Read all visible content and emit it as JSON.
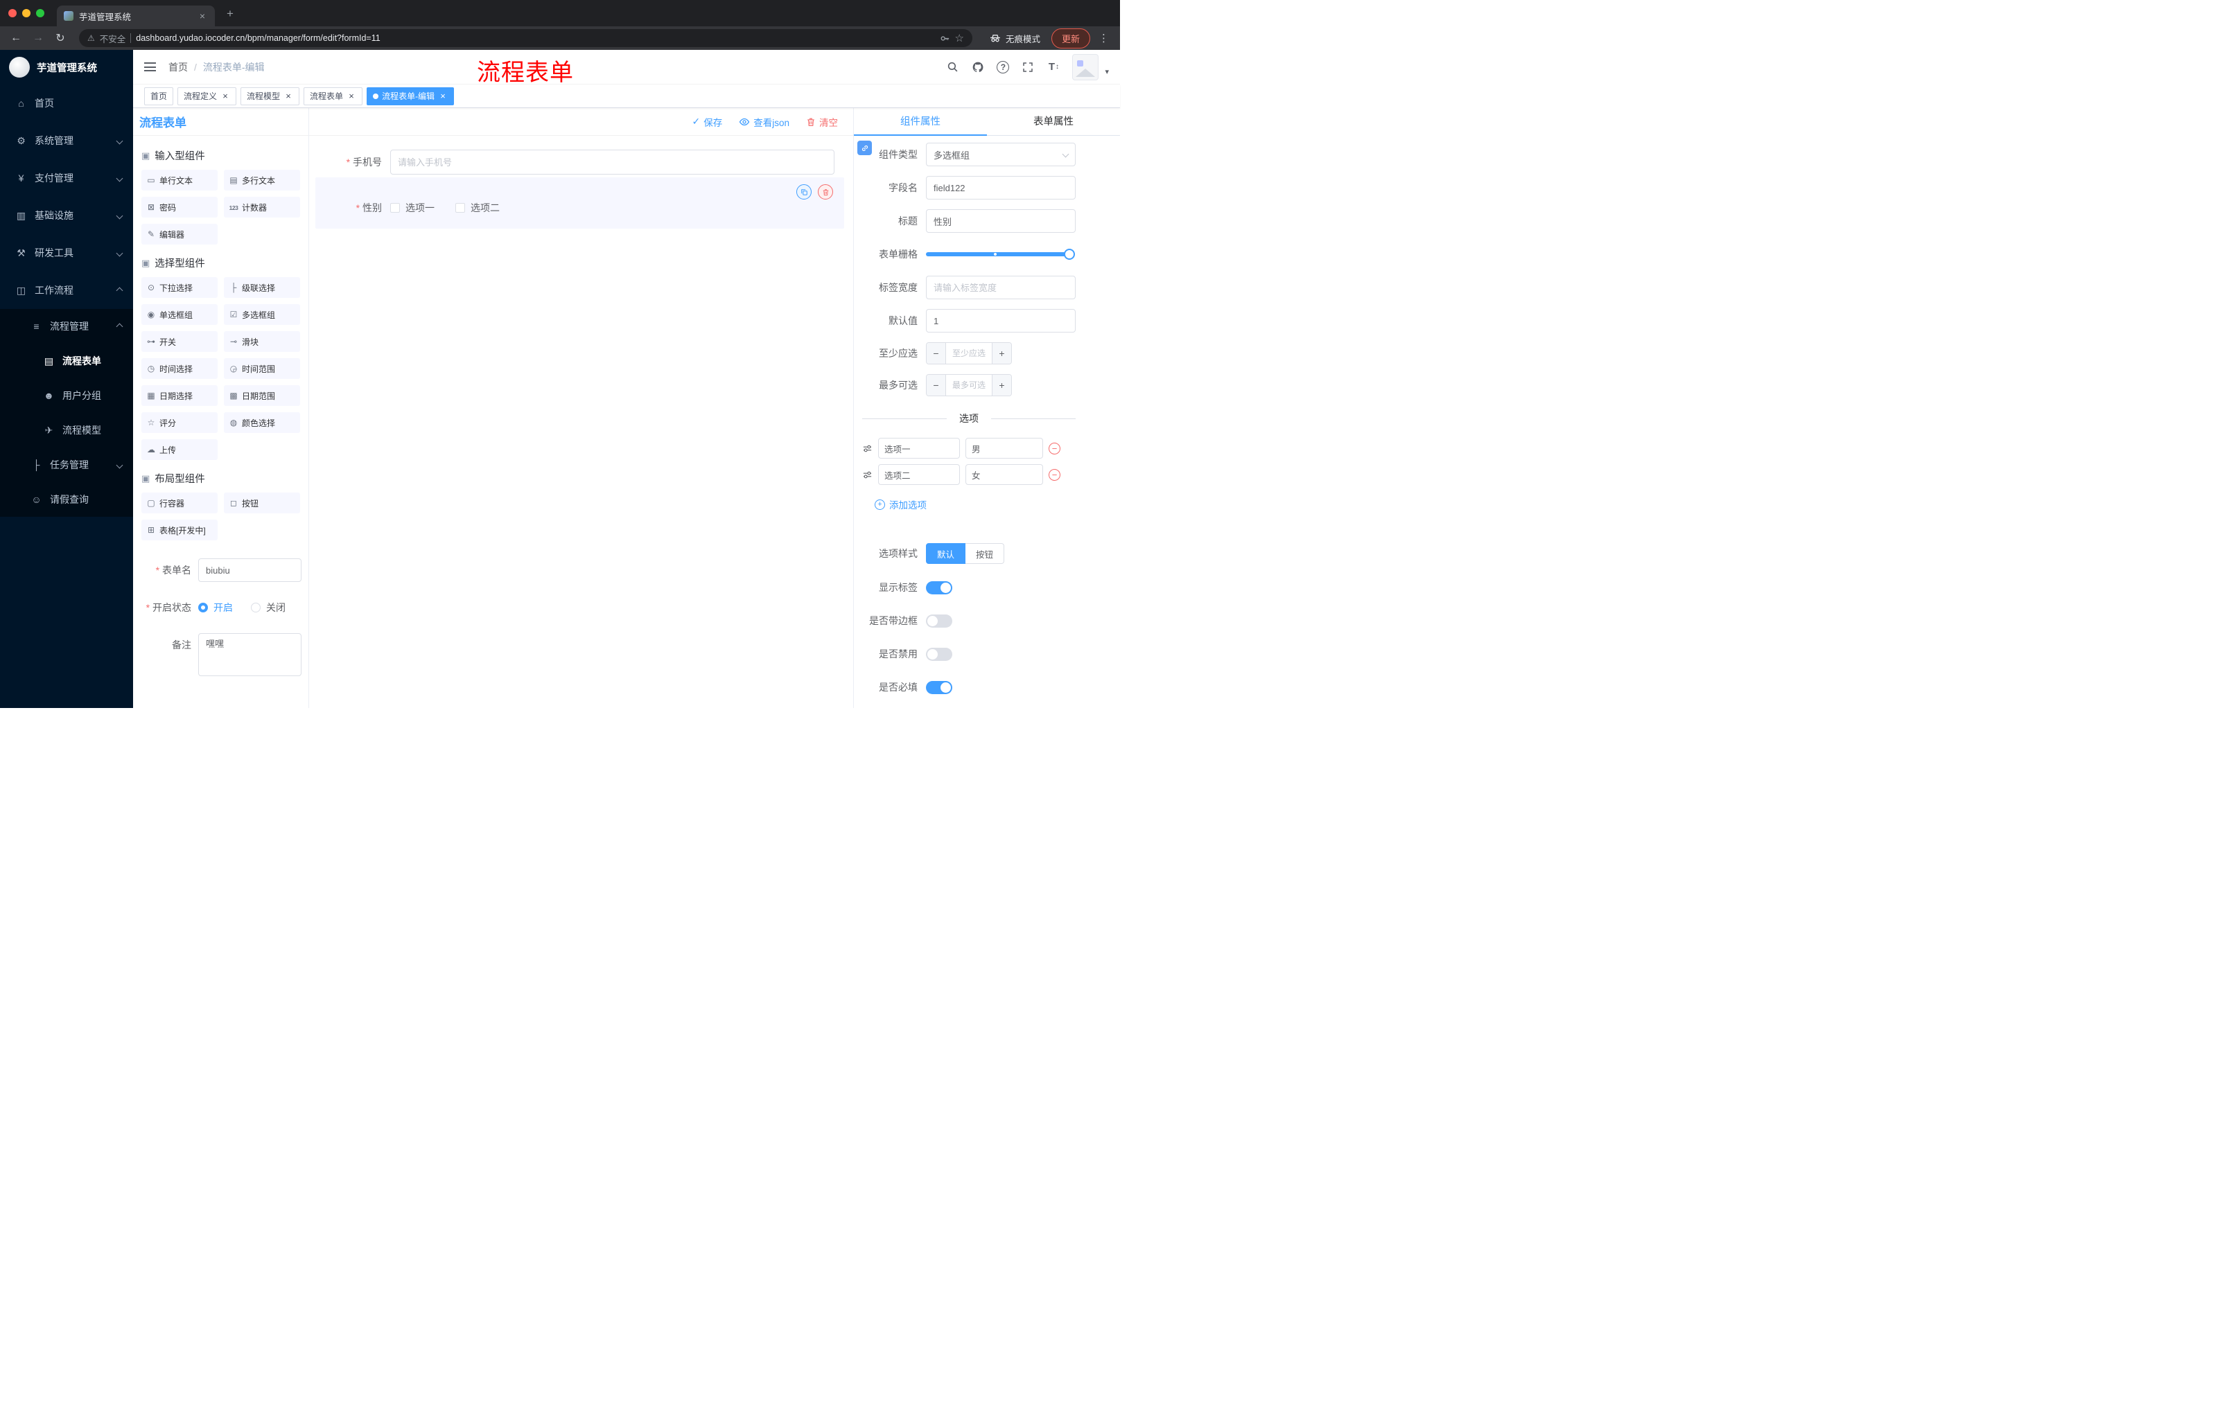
{
  "browser": {
    "tab_title": "芋道管理系统",
    "security_label": "不安全",
    "url": "dashboard.yudao.iocoder.cn/bpm/manager/form/edit?formId=11",
    "incognito_label": "无痕模式",
    "update_label": "更新",
    "icons": [
      "back-icon",
      "forward-icon",
      "reload-icon",
      "warning-icon",
      "key-icon",
      "bookmark-star-icon",
      "incognito-icon",
      "menu-dots-icon"
    ]
  },
  "sidebar": {
    "app_title": "芋道管理系统",
    "menu": [
      {
        "label": "首页",
        "icon": "dashboard-icon"
      },
      {
        "label": "系统管理",
        "icon": "gear-icon"
      },
      {
        "label": "支付管理",
        "icon": "payment-icon"
      },
      {
        "label": "基础设施",
        "icon": "infrastructure-icon"
      },
      {
        "label": "研发工具",
        "icon": "tools-icon"
      },
      {
        "label": "工作流程",
        "icon": "workflow-icon"
      }
    ],
    "submenu": [
      {
        "label": "流程管理",
        "icon": "list-icon"
      },
      {
        "label": "流程表单",
        "icon": "form-icon",
        "active": true
      },
      {
        "label": "用户分组",
        "icon": "users-icon"
      },
      {
        "label": "流程模型",
        "icon": "send-icon"
      },
      {
        "label": "任务管理",
        "icon": "tree-icon"
      },
      {
        "label": "请假查询",
        "icon": "user-icon"
      }
    ]
  },
  "header": {
    "breadcrumb_home": "首页",
    "breadcrumb_current": "流程表单-编辑",
    "annotation": "流程表单",
    "icons": [
      "search-icon",
      "github-icon",
      "help-icon",
      "fullscreen-icon",
      "font-size-icon",
      "caret-down-icon"
    ]
  },
  "tags": [
    {
      "label": "首页"
    },
    {
      "label": "流程定义"
    },
    {
      "label": "流程模型"
    },
    {
      "label": "流程表单"
    },
    {
      "label": "流程表单-编辑",
      "active": true
    }
  ],
  "designer": {
    "title": "流程表单",
    "save": "保存",
    "view_json": "查看json",
    "clear": "清空",
    "groups": [
      {
        "title": "输入型组件",
        "items": [
          {
            "label": "单行文本",
            "icon": "single-line-icon"
          },
          {
            "label": "多行文本",
            "icon": "multi-line-icon"
          },
          {
            "label": "密码",
            "icon": "password-icon"
          },
          {
            "label": "计数器",
            "icon": "counter-icon"
          },
          {
            "label": "编辑器",
            "icon": "editor-icon"
          }
        ]
      },
      {
        "title": "选择型组件",
        "items": [
          {
            "label": "下拉选择",
            "icon": "select-icon"
          },
          {
            "label": "级联选择",
            "icon": "cascader-icon"
          },
          {
            "label": "单选框组",
            "icon": "radio-group-icon"
          },
          {
            "label": "多选框组",
            "icon": "checkbox-group-icon"
          },
          {
            "label": "开关",
            "icon": "switch-icon"
          },
          {
            "label": "滑块",
            "icon": "slider-icon"
          },
          {
            "label": "时间选择",
            "icon": "time-icon"
          },
          {
            "label": "时间范围",
            "icon": "time-range-icon"
          },
          {
            "label": "日期选择",
            "icon": "date-icon"
          },
          {
            "label": "日期范围",
            "icon": "date-range-icon"
          },
          {
            "label": "评分",
            "icon": "rate-icon"
          },
          {
            "label": "颜色选择",
            "icon": "color-icon"
          },
          {
            "label": "上传",
            "icon": "upload-icon"
          }
        ]
      },
      {
        "title": "布局型组件",
        "items": [
          {
            "label": "行容器",
            "icon": "row-container-icon"
          },
          {
            "label": "按钮",
            "icon": "button-icon"
          },
          {
            "label": "表格[开发中]",
            "icon": "table-icon"
          }
        ]
      }
    ],
    "meta": {
      "name_label": "表单名",
      "name_value": "biubiu",
      "status_label": "开启状态",
      "status_on": "开启",
      "status_off": "关闭",
      "remark_label": "备注",
      "remark_value": "嘿嘿"
    },
    "canvas": {
      "phone_label": "手机号",
      "phone_placeholder": "请输入手机号",
      "gender_label": "性别",
      "gender_options": [
        {
          "label": "选项一"
        },
        {
          "label": "选项二"
        }
      ]
    }
  },
  "props": {
    "tab_component": "组件属性",
    "tab_form": "表单属性",
    "component_type_label": "组件类型",
    "component_type_value": "多选框组",
    "field_name_label": "字段名",
    "field_name_value": "field122",
    "title_label": "标题",
    "title_value": "性别",
    "grid_label": "表单栅格",
    "label_width_label": "标签宽度",
    "label_width_placeholder": "请输入标签宽度",
    "default_label": "默认值",
    "default_value": "1",
    "min_label": "至少应选",
    "min_placeholder": "至少应选",
    "max_label": "最多可选",
    "max_placeholder": "最多可选",
    "options_title": "选项",
    "options": [
      {
        "label": "选项一",
        "value": "男"
      },
      {
        "label": "选项二",
        "value": "女"
      }
    ],
    "add_option": "添加选项",
    "style_label": "选项样式",
    "style_default": "默认",
    "style_button": "按钮",
    "toggles": [
      {
        "label": "显示标签",
        "on": true
      },
      {
        "label": "是否带边框",
        "on": false
      },
      {
        "label": "是否禁用",
        "on": false
      },
      {
        "label": "是否必填",
        "on": true
      }
    ]
  },
  "colors": {
    "accent": "#409eff",
    "danger": "#f56c6c",
    "annotation": "#fe0100",
    "sidebar_bg": "#001529",
    "submenu_bg": "#000c17"
  }
}
